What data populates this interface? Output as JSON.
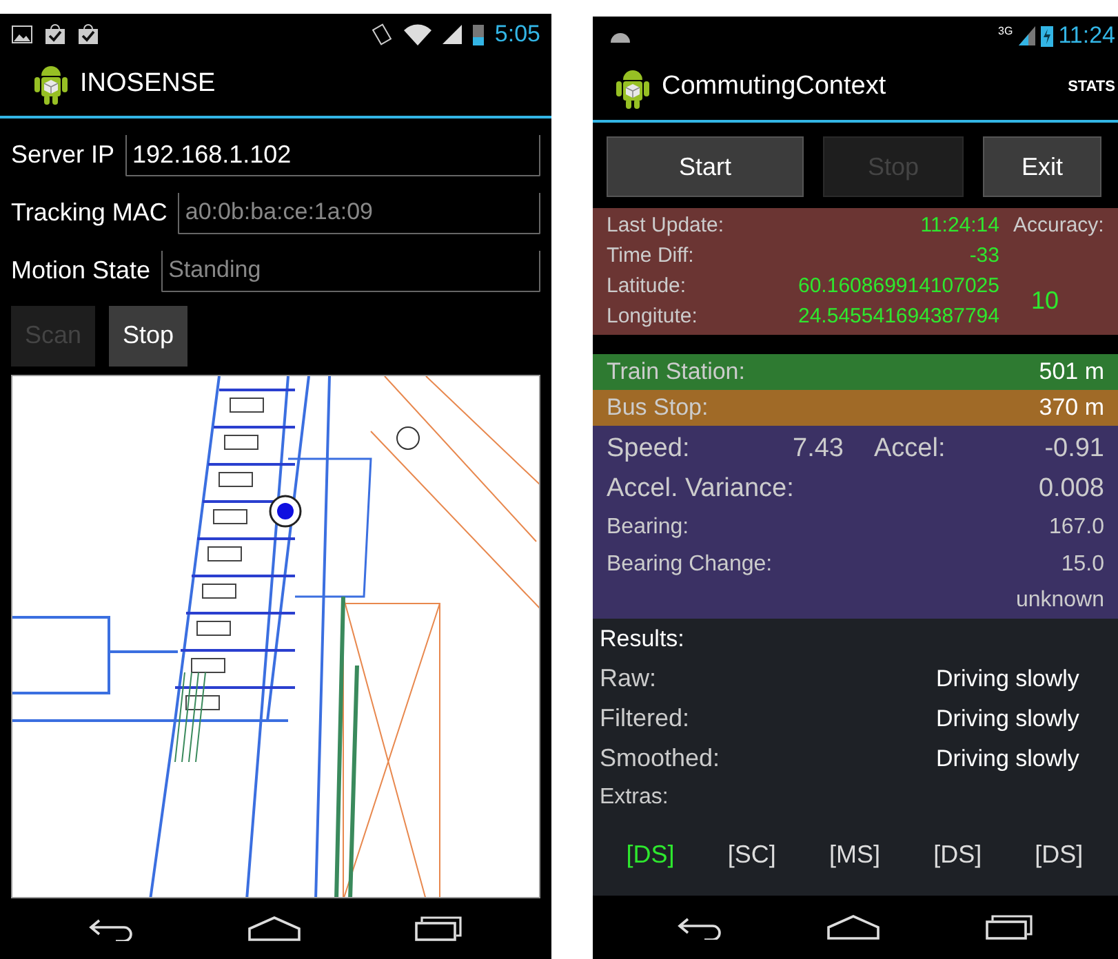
{
  "left_phone": {
    "status_bar": {
      "time": "5:05"
    },
    "app_bar": {
      "title": "INOSENSE"
    },
    "fields": [
      {
        "label": "Server IP",
        "value": "192.168.1.102",
        "disabled": false
      },
      {
        "label": "Tracking MAC",
        "value": "a0:0b:ba:ce:1a:09",
        "disabled": true
      },
      {
        "label": "Motion State",
        "value": "Standing",
        "disabled": true
      }
    ],
    "buttons": [
      {
        "label": "Scan",
        "disabled": true
      },
      {
        "label": "Stop",
        "disabled": false
      }
    ]
  },
  "right_phone": {
    "status_bar": {
      "network": "3G",
      "time": "11:24"
    },
    "app_bar": {
      "title": "CommutingContext",
      "action": "STATS"
    },
    "buttons": [
      {
        "label": "Start",
        "disabled": false
      },
      {
        "label": "Stop",
        "disabled": true
      },
      {
        "label": "Exit",
        "disabled": false
      }
    ],
    "location": {
      "last_update_label": "Last Update:",
      "last_update": "11:24:14",
      "time_diff_label": "Time Diff:",
      "time_diff": "-33",
      "latitude_label": "Latitude:",
      "latitude": "60.160869914107025",
      "longitude_label": "Longitute:",
      "longitude": "24.545541694387794",
      "accuracy_label": "Accuracy:",
      "accuracy": "10"
    },
    "nearby": [
      {
        "label": "Train Station:",
        "value": "501 m",
        "color": "#2e7a31"
      },
      {
        "label": "Bus Stop:",
        "value": "370 m",
        "color": "#a06a27"
      }
    ],
    "motion": {
      "speed_label": "Speed:",
      "speed": "7.43",
      "accel_label": "Accel:",
      "accel": "-0.91",
      "rows": [
        {
          "label": "Accel. Variance:",
          "value": "0.008",
          "kind": "large"
        },
        {
          "label": "Bearing:",
          "value": "167.0",
          "kind": "small"
        },
        {
          "label": "Bearing Change:",
          "value": "15.0",
          "kind": "small"
        }
      ],
      "status": "unknown"
    },
    "results": {
      "heading": "Results:",
      "rows": [
        {
          "label": "Raw:",
          "value": "Driving slowly"
        },
        {
          "label": "Filtered:",
          "value": "Driving slowly"
        },
        {
          "label": "Smoothed:",
          "value": "Driving slowly"
        }
      ],
      "extras_label": "Extras:",
      "extras": [
        {
          "label": "[DS]",
          "selected": true
        },
        {
          "label": "[SC]",
          "selected": false
        },
        {
          "label": "[MS]",
          "selected": false
        },
        {
          "label": "[DS]",
          "selected": false
        },
        {
          "label": "[DS]",
          "selected": false
        }
      ]
    }
  }
}
